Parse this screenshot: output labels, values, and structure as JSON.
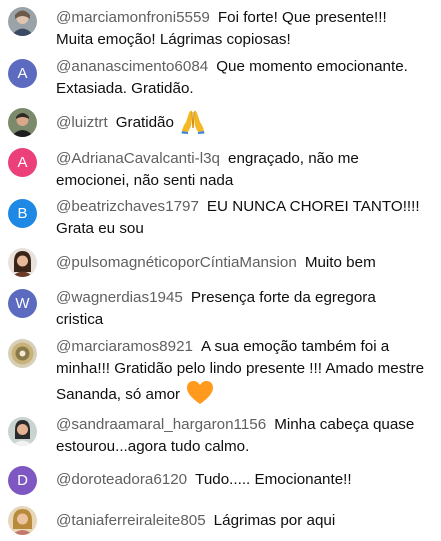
{
  "messages": [
    {
      "author": "@marciamonfroni5559",
      "text": "Foi forte! Que presente!!! Muita emoção! Lágrimas copiosas!",
      "avatar_type": "photo",
      "avatar_icon": "user-photo"
    },
    {
      "author": "@ananascimento6084",
      "text": "Que momento emocionante. Extasiada. Gratidão.",
      "avatar_type": "letter",
      "avatar_letter": "A",
      "avatar_color": "#5c6bc0"
    },
    {
      "author": "@luiztrt",
      "text": "Gratidão",
      "emoji": "folded-hands-icon",
      "avatar_type": "photo",
      "avatar_icon": "user-photo"
    },
    {
      "author": "@AdrianaCavalcanti-l3q",
      "text": "engraçado, não me emocionei, não senti nada",
      "avatar_type": "letter",
      "avatar_letter": "A",
      "avatar_color": "#ec407a"
    },
    {
      "author": "@beatrizchaves1797",
      "text": "EU NUNCA CHOREI TANTO!!!! Grata eu sou",
      "avatar_type": "letter",
      "avatar_letter": "B",
      "avatar_color": "#1e88e5"
    },
    {
      "author": "@pulsomagnéticoporCíntiaMansion",
      "text": "Muito bem",
      "avatar_type": "photo",
      "avatar_icon": "user-photo"
    },
    {
      "author": "@wagnerdias1945",
      "text": "Presença forte da egregora cristica",
      "avatar_type": "letter",
      "avatar_letter": "W",
      "avatar_color": "#5c6bc0"
    },
    {
      "author": "@marciaramos8921",
      "text": "A sua emoção também foi a minha!!! Gratidão pelo lindo presente !!! Amado mestre Sananda, só amor",
      "emoji": "orange-heart-icon",
      "avatar_type": "photo",
      "avatar_icon": "user-photo"
    },
    {
      "author": "@sandraamaral_hargaron1156",
      "text": "Minha cabeça quase estourou...agora tudo calmo.",
      "avatar_type": "photo",
      "avatar_icon": "user-photo"
    },
    {
      "author": "@doroteadora6120",
      "text": "Tudo..... Emocionante!!",
      "avatar_type": "letter",
      "avatar_letter": "D",
      "avatar_color": "#7e57c2"
    },
    {
      "author": "@taniaferreiraleite805",
      "text": "Lágrimas por aqui",
      "avatar_type": "photo",
      "avatar_icon": "user-photo"
    }
  ]
}
